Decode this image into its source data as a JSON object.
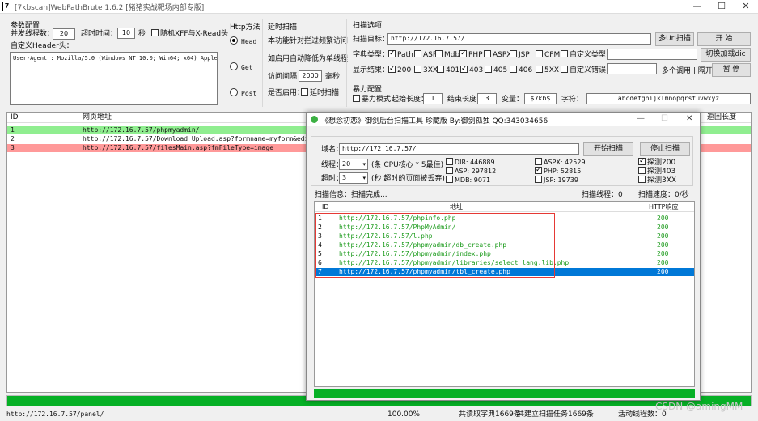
{
  "window": {
    "title": "[7kbscan]WebPathBrute 1.6.2 [猪猪实战靶场内部专版]",
    "minimize": "—",
    "maximize": "☐",
    "close": "✕"
  },
  "params": {
    "group_title": "参数配置",
    "threads_label": "并发线程数：",
    "threads_value": "20",
    "timeout_label": "超时时间：",
    "timeout_value": "10",
    "timeout_unit": "秒",
    "random_xff_label": "随机XFF与X-Read头",
    "header_label": "自定义Header头：",
    "header_value": "User-Agent : Mozilla/5.0 (Windows NT 10.0; Win64; x64) AppleWebK"
  },
  "http_method": {
    "title": "Http方法",
    "options": [
      "Head",
      "Get",
      "Post"
    ],
    "selected": "Head"
  },
  "delay": {
    "title": "延时扫描",
    "desc1": "本功能针对拦过频繁访问",
    "desc2": "如启用自动降低为单线程",
    "interval_label": "访问间隔",
    "interval_value": "2000",
    "interval_unit": "毫秒",
    "enable_label": "是否启用：",
    "enable_check_label": "延时扫描"
  },
  "scan_opts": {
    "title": "扫描选项",
    "target_label": "扫描目标：",
    "target_value": "http://172.16.7.57/",
    "btn_multi_url": "多Url扫描",
    "btn_start": "开 始",
    "dict_label": "字典类型：",
    "dict_items": [
      {
        "label": "Path",
        "checked": true
      },
      {
        "label": "ASP",
        "checked": false
      },
      {
        "label": "Mdb",
        "checked": false
      },
      {
        "label": "PHP",
        "checked": true
      },
      {
        "label": "ASPX",
        "checked": false
      },
      {
        "label": "JSP",
        "checked": false
      },
      {
        "label": "CFM",
        "checked": false
      },
      {
        "label": "自定义类型",
        "checked": false
      }
    ],
    "btn_switch_dict": "切换加载dic",
    "show_label": "显示结果：",
    "show_items": [
      {
        "label": "200",
        "checked": true
      },
      {
        "label": "3XX",
        "checked": false
      },
      {
        "label": "401",
        "checked": false
      },
      {
        "label": "403",
        "checked": true
      },
      {
        "label": "405",
        "checked": false
      },
      {
        "label": "406",
        "checked": false
      },
      {
        "label": "5XX",
        "checked": false
      },
      {
        "label": "自定义错误",
        "checked": false
      }
    ],
    "multi_call_label": "多个调用 | 隔开",
    "btn_pause": "暂 停"
  },
  "brute": {
    "title": "暴力配置",
    "mode_label": "暴力模式",
    "start_len_label": "起始长度：",
    "start_len_value": "1",
    "end_len_label": "结束长度：",
    "end_len_value": "3",
    "var_label": "变量：",
    "var_value": "$7kb$",
    "charset_label": "字符：",
    "charset_value": "abcdefghijklmnopqrstuvwxyz"
  },
  "results": {
    "col_id": "ID",
    "col_url": "网页地址",
    "col_status": "返回长度",
    "rows": [
      {
        "id": "1",
        "url": "http://172.16.7.57/phpmyadmin/",
        "color": "#90ee90"
      },
      {
        "id": "2",
        "url": "http://172.16.7.57/Download_Upload.asp?formname=myform&editname=Imag",
        "color": "#ffffff"
      },
      {
        "id": "3",
        "url": "http://172.16.7.57/filesMain.asp?fmFileType=image",
        "color": "#ff9999"
      }
    ]
  },
  "statusbar": {
    "url": "http://172.16.7.57/panel/",
    "percent": "100.00%",
    "dict_count": "共读取字典1669条",
    "task_count": "共建立扫描任务1669条",
    "active_threads": "活动线程数：0"
  },
  "watermark": "CSDN @amingMM",
  "dialog": {
    "title": "《想念初恋》御剑后台扫描工具 珍藏版 By:御剑孤独 QQ:343034656",
    "domain_label": "域名：",
    "domain_value": "http://172.16.7.57/",
    "btn_start": "开始扫描",
    "btn_stop": "停止扫描",
    "thread_label": "线程：",
    "thread_value": "20",
    "thread_note": "(条 CPU核心 * 5最佳)",
    "timeout_label": "超时：",
    "timeout_value": "3",
    "timeout_note": "(秒 超时的页面被丢弃)",
    "dicts": [
      {
        "label": "DIR: 446889",
        "checked": false
      },
      {
        "label": "ASP: 297812",
        "checked": false
      },
      {
        "label": "MDB: 9071",
        "checked": false
      },
      {
        "label": "ASPX: 42529",
        "checked": false
      },
      {
        "label": "PHP: 52815",
        "checked": true
      },
      {
        "label": "JSP: 19739",
        "checked": false
      }
    ],
    "probes": [
      {
        "label": "探测200",
        "checked": true
      },
      {
        "label": "探测403",
        "checked": false
      },
      {
        "label": "探测3XX",
        "checked": false
      }
    ],
    "info_label": "扫描信息：扫描完成...",
    "scan_threads": "扫描线程：0",
    "scan_speed": "扫描速度：0/秒",
    "col_id": "ID",
    "col_url": "地址",
    "col_http": "HTTP响应",
    "rows": [
      {
        "id": "1",
        "url": "http://172.16.7.57/phpinfo.php",
        "code": "200"
      },
      {
        "id": "2",
        "url": "http://172.16.7.57/PhpMyAdmin/",
        "code": "200"
      },
      {
        "id": "3",
        "url": "http://172.16.7.57/l.php",
        "code": "200"
      },
      {
        "id": "4",
        "url": "http://172.16.7.57/phpmyadmin/db_create.php",
        "code": "200"
      },
      {
        "id": "5",
        "url": "http://172.16.7.57/phpmyadmin/index.php",
        "code": "200"
      },
      {
        "id": "6",
        "url": "http://172.16.7.57/phpmyadmin/libraries/select_lang.lib.php",
        "code": "200"
      },
      {
        "id": "7",
        "url": "http://172.16.7.57/phpmyadmin/tbl_create.php",
        "code": "200"
      }
    ],
    "selected_row": "7",
    "progress": 1.0,
    "accent": "#0078d7",
    "progress_color": "#06b025"
  }
}
